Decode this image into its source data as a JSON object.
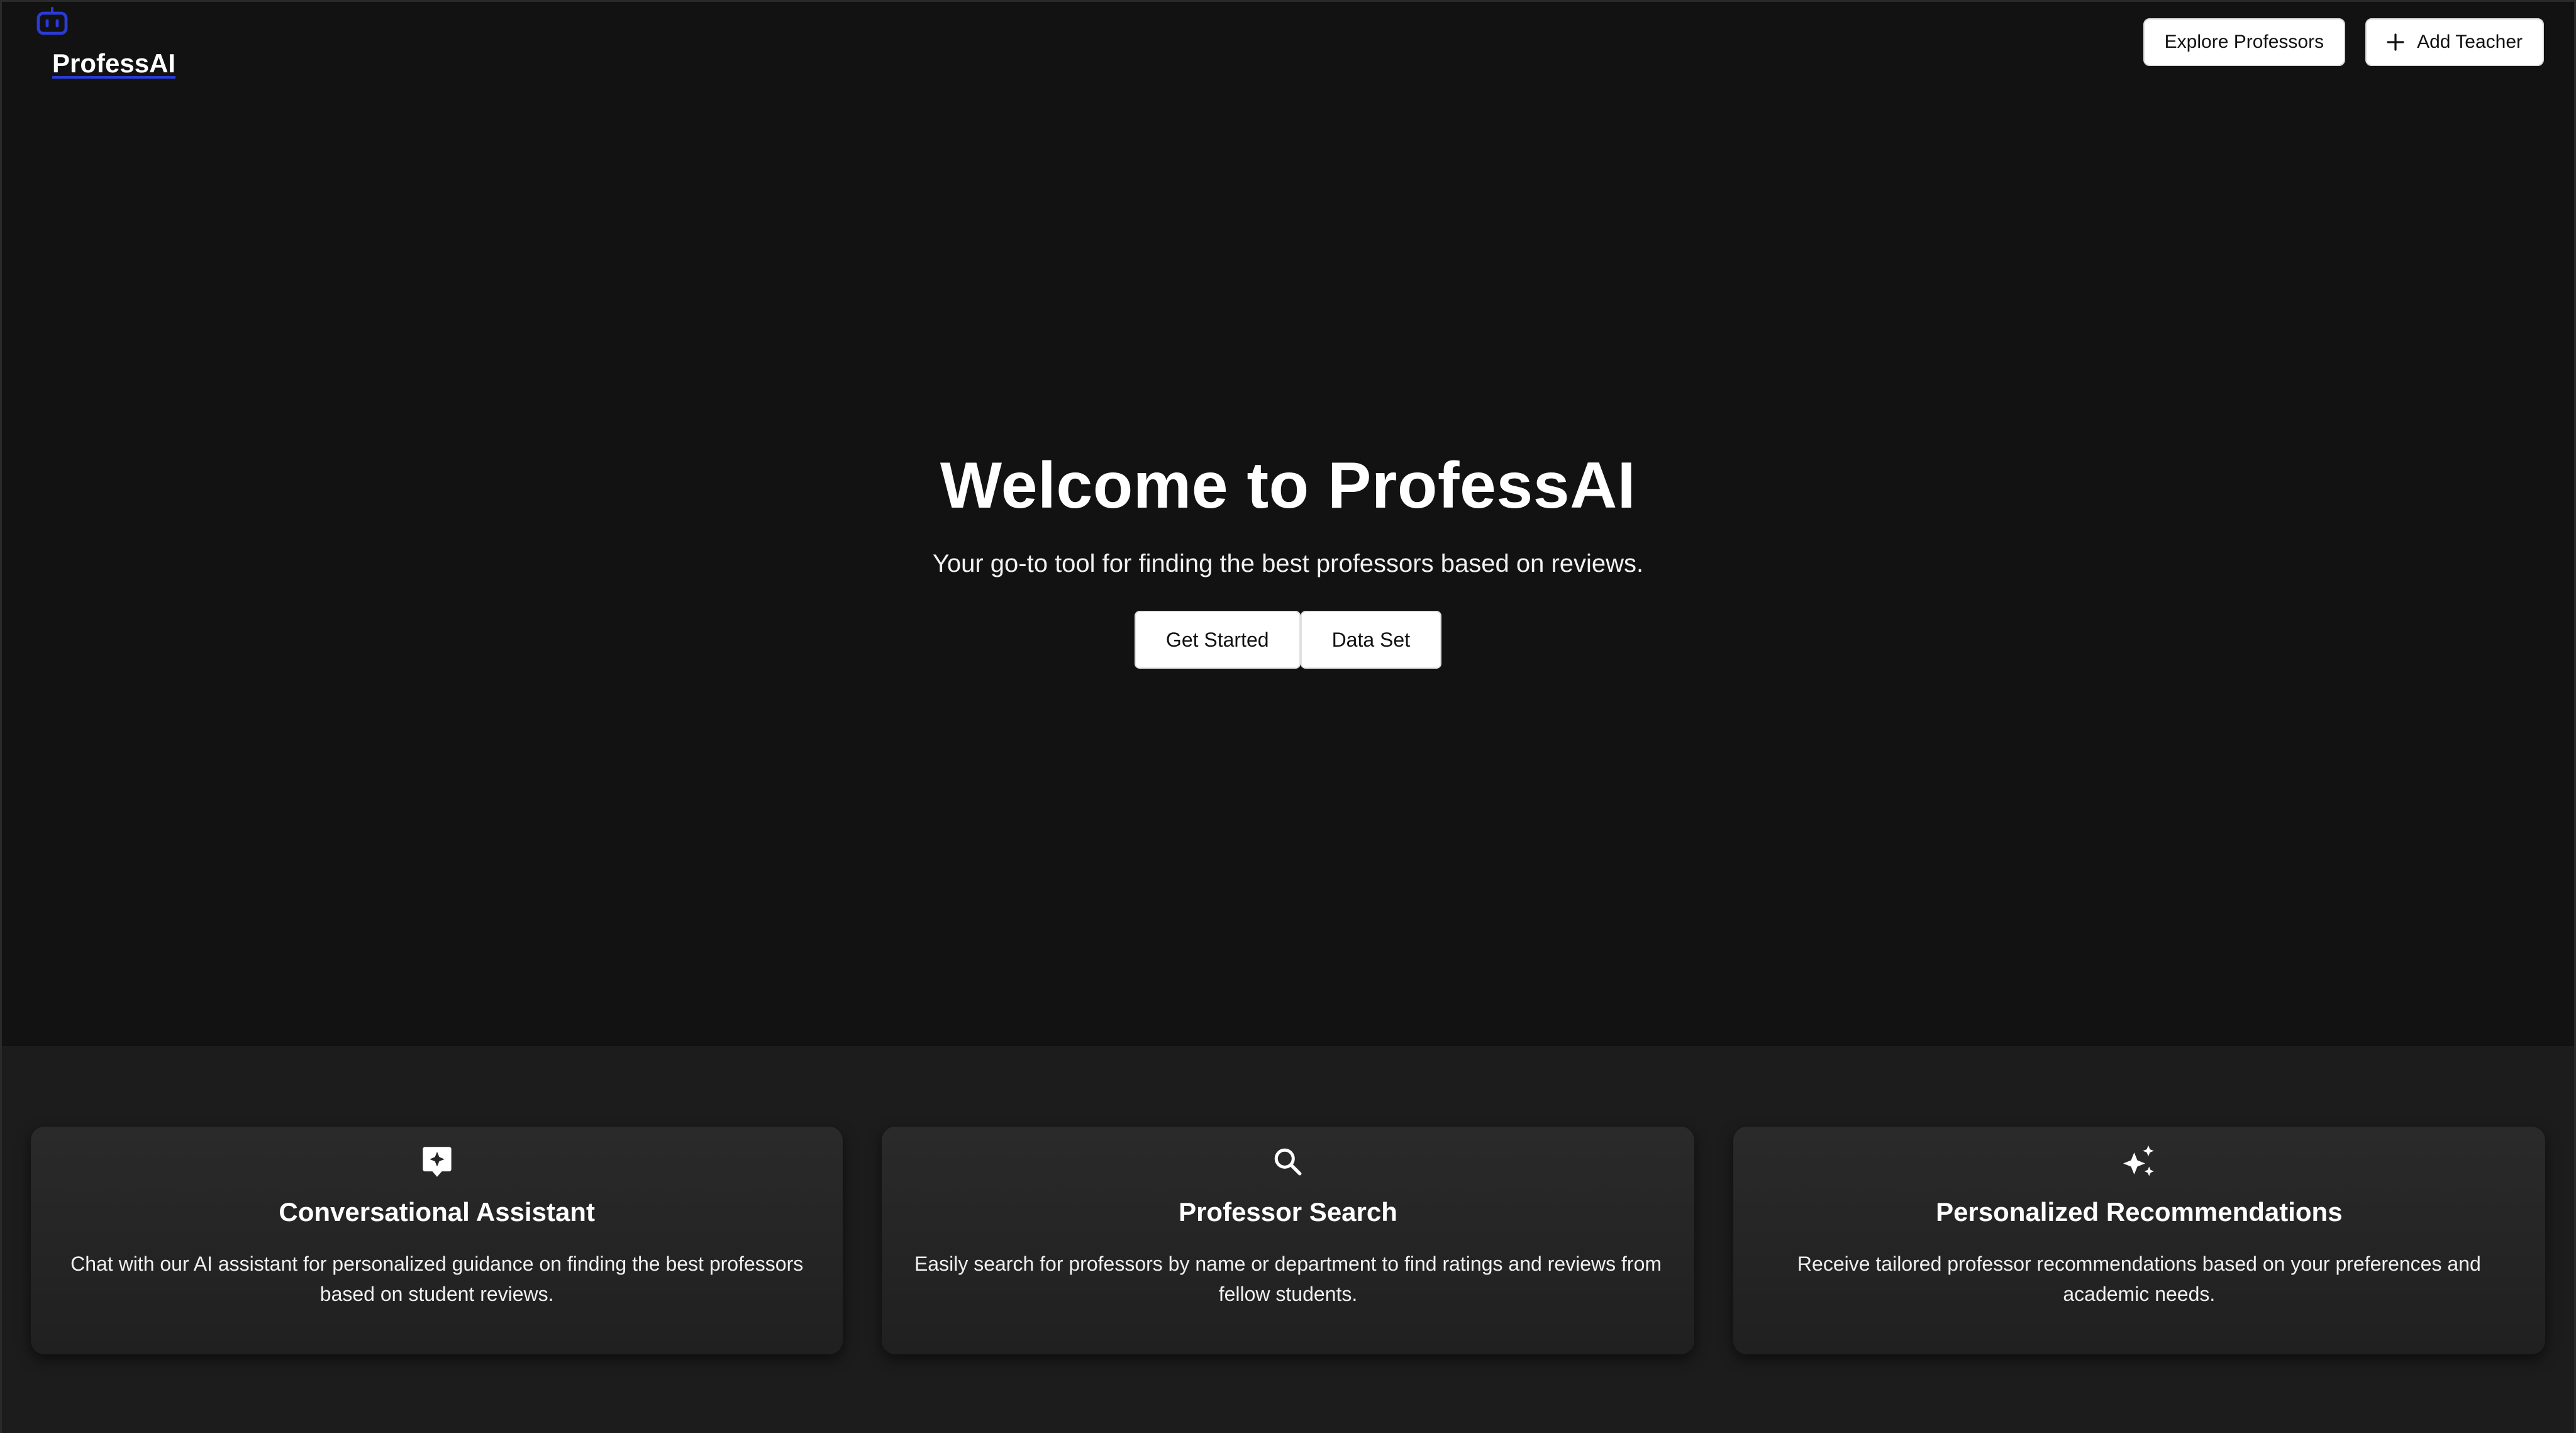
{
  "brand": {
    "name": "ProfessAI",
    "icon": "robot-icon",
    "accent_color": "#2b3bd6"
  },
  "nav": {
    "explore_label": "Explore Professors",
    "add_teacher_label": "Add Teacher",
    "add_teacher_icon": "plus-icon"
  },
  "hero": {
    "title": "Welcome to ProfessAI",
    "subtitle": "Your go-to tool for finding the best professors based on reviews.",
    "get_started_label": "Get Started",
    "data_set_label": "Data Set"
  },
  "features": [
    {
      "icon": "chat-sparkle-icon",
      "title": "Conversational Assistant",
      "text": "Chat with our AI assistant for personalized guidance on finding the best professors based on student reviews."
    },
    {
      "icon": "search-icon",
      "title": "Professor Search",
      "text": "Easily search for professors by name or department to find ratings and reviews from fellow students."
    },
    {
      "icon": "sparkles-icon",
      "title": "Personalized Recommendations",
      "text": "Receive tailored professor recommendations based on your preferences and academic needs."
    }
  ],
  "colors": {
    "background": "#121212",
    "features_background": "#1c1c1c",
    "card_background": "#262626",
    "button_background": "#ffffff"
  }
}
